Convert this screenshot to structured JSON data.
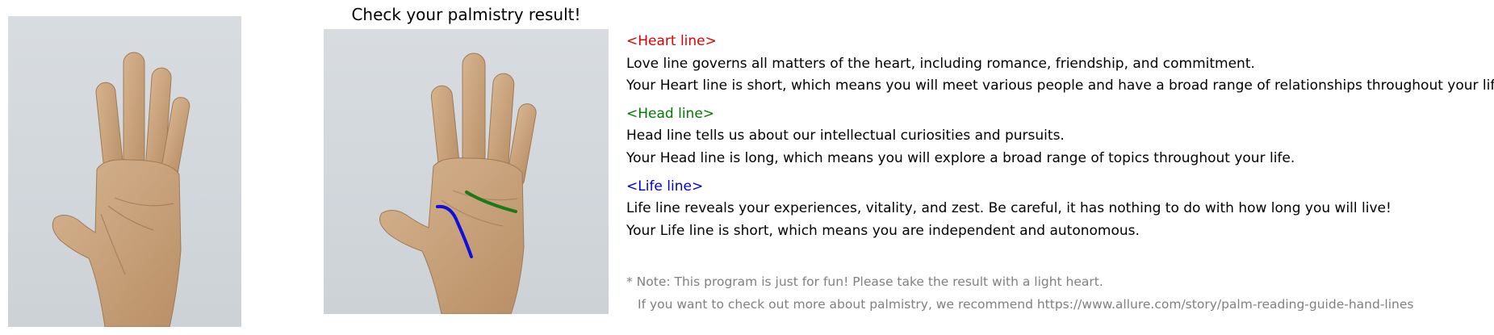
{
  "title": "Check your palmistry result!",
  "sections": [
    {
      "header": "<Heart line>",
      "color": "#dd0000",
      "description": "Love line governs all matters of the heart, including romance, friendship, and commitment.",
      "result": "Your Heart line is short, which means you will meet various people and have a broad range of relationships throughout your life."
    },
    {
      "header": "<Head line>",
      "color": "#007a00",
      "description": "Head line tells us about our intellectual curiosities and pursuits.",
      "result": "Your Head line is long, which means you will explore a broad range of topics throughout your life."
    },
    {
      "header": "<Life line>",
      "color": "#0000cc",
      "description": "Life line reveals your experiences, vitality, and zest. Be careful, it has nothing to do with how long you will live!",
      "result": "Your Life line is short, which means you are independent and autonomous."
    }
  ],
  "note": {
    "line1": "* Note: This program is just for fun! Please take the result with a light heart.",
    "line2": "If you want to check out more about palmistry, we recommend https://www.allure.com/story/palm-reading-guide-hand-lines"
  },
  "overlay_colors": {
    "head_line": "#1a7a1a",
    "life_line": "#1010dd"
  }
}
